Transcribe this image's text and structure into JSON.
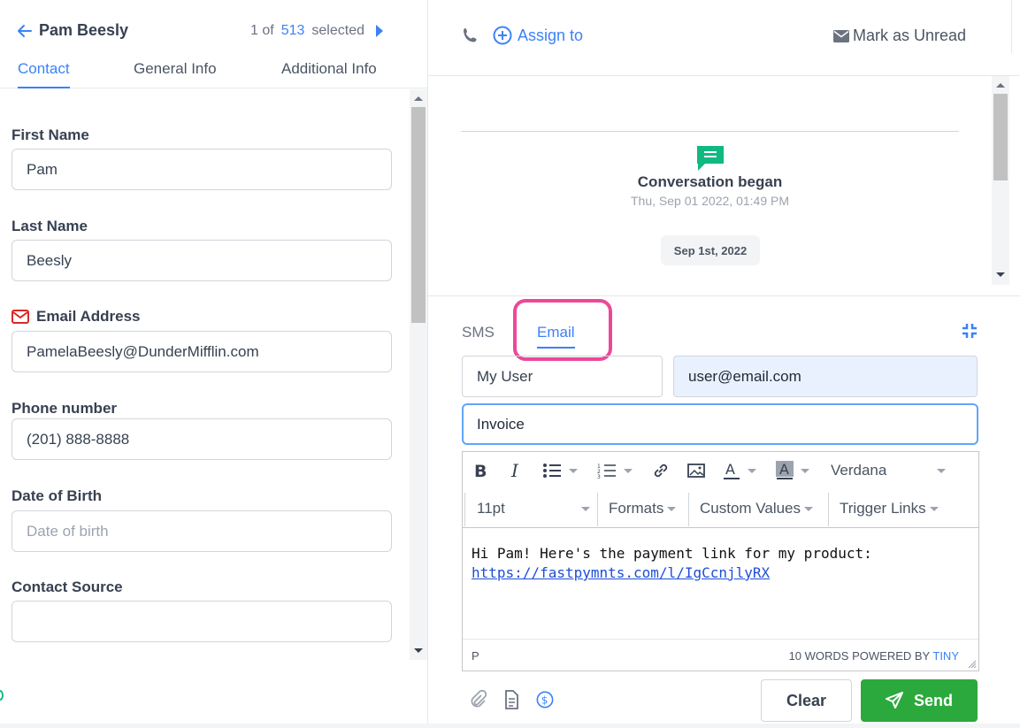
{
  "contact": {
    "name": "Pam Beesly",
    "pager_prefix": "1 of",
    "pager_count": "513",
    "pager_suffix": "selected"
  },
  "tabs": [
    {
      "label": "Contact",
      "active": true
    },
    {
      "label": "General Info",
      "active": false
    },
    {
      "label": "Additional Info",
      "active": false
    }
  ],
  "form": {
    "first_name_label": "First Name",
    "first_name_value": "Pam",
    "last_name_label": "Last Name",
    "last_name_value": "Beesly",
    "email_label": "Email Address",
    "email_value": "PamelaBeesly@DunderMifflin.com",
    "phone_label": "Phone number",
    "phone_value": "(201) 888-8888",
    "dob_label": "Date of Birth",
    "dob_placeholder": "Date of birth",
    "source_label": "Contact Source",
    "source_value": ""
  },
  "topbar": {
    "assign_label": "Assign to",
    "unread_label": "Mark as Unread"
  },
  "conversation": {
    "title": "Conversation began",
    "timestamp": "Thu, Sep 01 2022, 01:49 PM",
    "date_chip": "Sep 1st, 2022"
  },
  "compose": {
    "tab_sms": "SMS",
    "tab_email": "Email",
    "from_name": "My User",
    "from_email": "user@email.com",
    "subject": "Invoice",
    "font_family": "Verdana",
    "font_size": "11pt",
    "formats_label": "Formats",
    "custom_values_label": "Custom Values",
    "trigger_links_label": "Trigger Links",
    "body_line1": "Hi Pam! Here's the payment link for my product:",
    "body_link": "https://fastpymnts.com/l/IgCcnjlyRX",
    "status_path": "P",
    "status_words": "10 WORDS POWERED BY",
    "status_brand": "TINY",
    "clear_label": "Clear",
    "send_label": "Send"
  },
  "colors": {
    "accent": "#3b82f6",
    "send_green": "#2ba93c",
    "highlight_pink": "#ec4899",
    "chat_green": "#10b981",
    "mail_red": "#dc2626"
  }
}
